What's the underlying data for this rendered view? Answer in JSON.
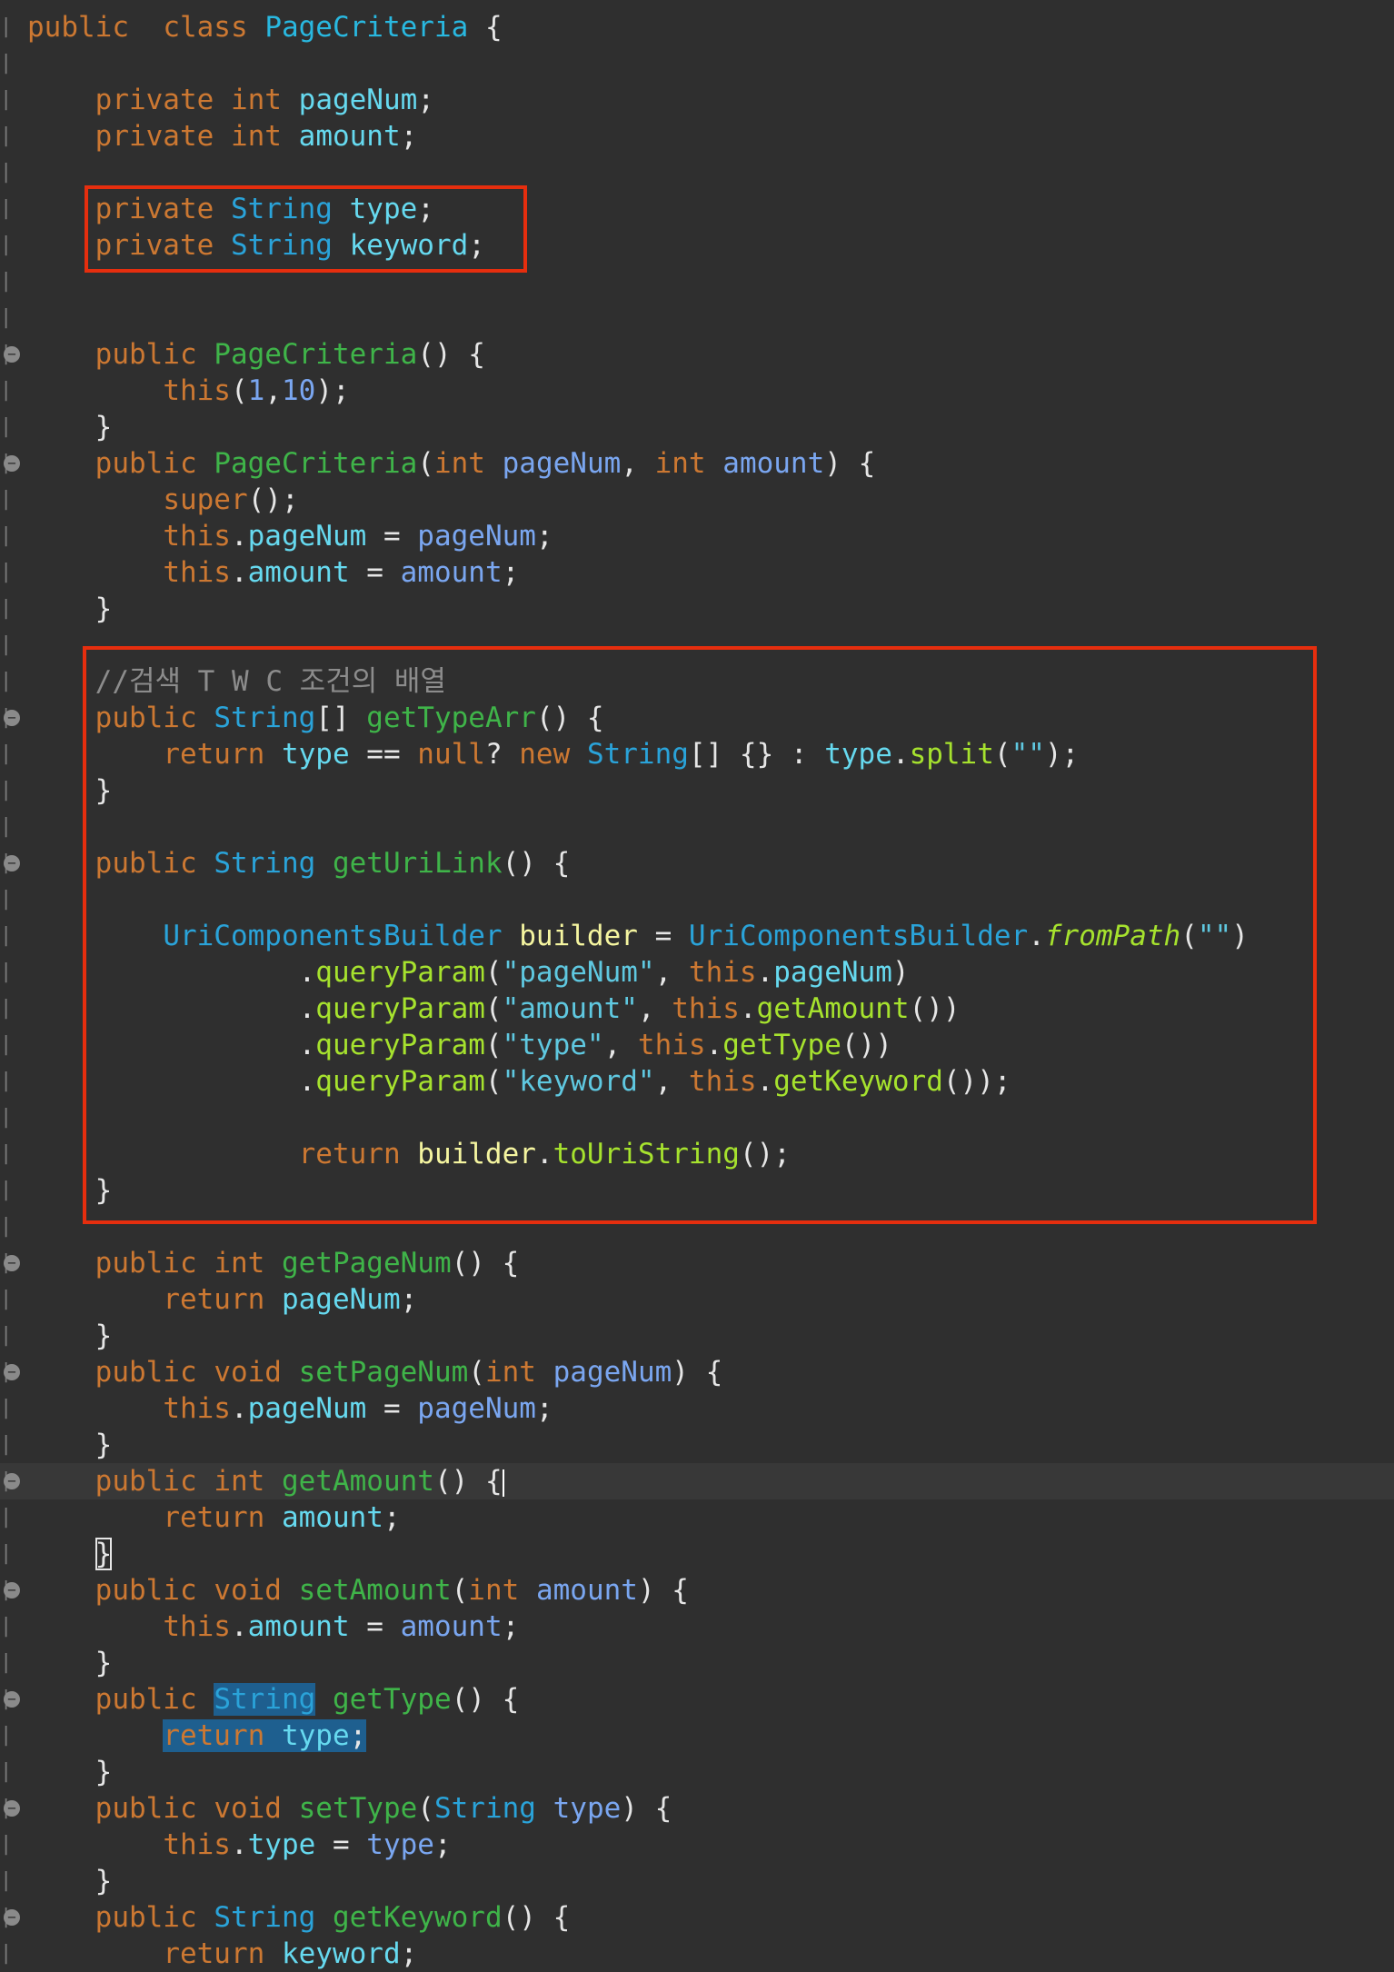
{
  "editor": {
    "language": "Java",
    "lines": [
      {
        "tokens": [
          [
            "kw",
            "public"
          ],
          [
            "",
            "  "
          ],
          [
            "kw",
            "class"
          ],
          [
            "",
            " "
          ],
          [
            "cls",
            "PageCriteria"
          ],
          [
            "",
            " {"
          ]
        ]
      },
      {
        "tokens": []
      },
      {
        "tokens": [
          [
            "",
            "    "
          ],
          [
            "kw",
            "private"
          ],
          [
            "",
            " "
          ],
          [
            "kw",
            "int"
          ],
          [
            "",
            " "
          ],
          [
            "fld",
            "pageNum"
          ],
          [
            "",
            ";"
          ]
        ]
      },
      {
        "tokens": [
          [
            "",
            "    "
          ],
          [
            "kw",
            "private"
          ],
          [
            "",
            " "
          ],
          [
            "kw",
            "int"
          ],
          [
            "",
            " "
          ],
          [
            "fld",
            "amount"
          ],
          [
            "",
            ";"
          ]
        ]
      },
      {
        "tokens": []
      },
      {
        "tokens": [
          [
            "",
            "    "
          ],
          [
            "kw",
            "private"
          ],
          [
            "",
            " "
          ],
          [
            "ty",
            "String"
          ],
          [
            "",
            " "
          ],
          [
            "fld",
            "type"
          ],
          [
            "",
            ";"
          ]
        ]
      },
      {
        "tokens": [
          [
            "",
            "    "
          ],
          [
            "kw",
            "private"
          ],
          [
            "",
            " "
          ],
          [
            "ty",
            "String"
          ],
          [
            "",
            " "
          ],
          [
            "fld",
            "keyword"
          ],
          [
            "",
            ";"
          ]
        ]
      },
      {
        "tokens": []
      },
      {
        "tokens": []
      },
      {
        "fold": true,
        "tokens": [
          [
            "",
            "    "
          ],
          [
            "kw",
            "public"
          ],
          [
            "",
            " "
          ],
          [
            "fn",
            "PageCriteria"
          ],
          [
            "",
            "() {"
          ]
        ]
      },
      {
        "tokens": [
          [
            "",
            "        "
          ],
          [
            "kw",
            "this"
          ],
          [
            "",
            "("
          ],
          [
            "num",
            "1"
          ],
          [
            "",
            ","
          ],
          [
            "num",
            "10"
          ],
          [
            "",
            ");"
          ]
        ]
      },
      {
        "tokens": [
          [
            "",
            "    }"
          ]
        ]
      },
      {
        "fold": true,
        "tokens": [
          [
            "",
            "    "
          ],
          [
            "kw",
            "public"
          ],
          [
            "",
            " "
          ],
          [
            "fn",
            "PageCriteria"
          ],
          [
            "",
            "("
          ],
          [
            "kw",
            "int"
          ],
          [
            "",
            " "
          ],
          [
            "par",
            "pageNum"
          ],
          [
            "",
            ", "
          ],
          [
            "kw",
            "int"
          ],
          [
            "",
            " "
          ],
          [
            "par",
            "amount"
          ],
          [
            "",
            ") {"
          ]
        ]
      },
      {
        "tokens": [
          [
            "",
            "        "
          ],
          [
            "kw",
            "super"
          ],
          [
            "",
            "();"
          ]
        ]
      },
      {
        "tokens": [
          [
            "",
            "        "
          ],
          [
            "kw",
            "this"
          ],
          [
            "",
            "."
          ],
          [
            "fld",
            "pageNum"
          ],
          [
            "",
            " = "
          ],
          [
            "par",
            "pageNum"
          ],
          [
            "",
            ";"
          ]
        ]
      },
      {
        "tokens": [
          [
            "",
            "        "
          ],
          [
            "kw",
            "this"
          ],
          [
            "",
            "."
          ],
          [
            "fld",
            "amount"
          ],
          [
            "",
            " = "
          ],
          [
            "par",
            "amount"
          ],
          [
            "",
            ";"
          ]
        ]
      },
      {
        "tokens": [
          [
            "",
            "    }"
          ]
        ]
      },
      {
        "tokens": []
      },
      {
        "tokens": [
          [
            "",
            "    "
          ],
          [
            "cm",
            "//검색 T W C 조건의 배열"
          ]
        ]
      },
      {
        "fold": true,
        "tokens": [
          [
            "",
            "    "
          ],
          [
            "kw",
            "public"
          ],
          [
            "",
            " "
          ],
          [
            "ty",
            "String"
          ],
          [
            "",
            "[] "
          ],
          [
            "fn",
            "getTypeArr"
          ],
          [
            "",
            "() {"
          ]
        ]
      },
      {
        "tokens": [
          [
            "",
            "        "
          ],
          [
            "kw",
            "return"
          ],
          [
            "",
            " "
          ],
          [
            "fld",
            "type"
          ],
          [
            "",
            " == "
          ],
          [
            "kw",
            "null"
          ],
          [
            "",
            "? "
          ],
          [
            "kw",
            "new"
          ],
          [
            "",
            " "
          ],
          [
            "ty",
            "String"
          ],
          [
            "",
            "[] {} : "
          ],
          [
            "fld",
            "type"
          ],
          [
            "",
            "."
          ],
          [
            "call",
            "split"
          ],
          [
            "",
            "("
          ],
          [
            "str",
            "\"\""
          ],
          [
            "",
            ");"
          ]
        ]
      },
      {
        "tokens": [
          [
            "",
            "    }"
          ]
        ]
      },
      {
        "tokens": []
      },
      {
        "fold": true,
        "tokens": [
          [
            "",
            "    "
          ],
          [
            "kw",
            "public"
          ],
          [
            "",
            " "
          ],
          [
            "ty",
            "String"
          ],
          [
            "",
            " "
          ],
          [
            "fn",
            "getUriLink"
          ],
          [
            "",
            "() {"
          ]
        ]
      },
      {
        "tokens": []
      },
      {
        "tokens": [
          [
            "",
            "        "
          ],
          [
            "ty",
            "UriComponentsBuilder"
          ],
          [
            "",
            " "
          ],
          [
            "loc",
            "builder"
          ],
          [
            "",
            " = "
          ],
          [
            "ty",
            "UriComponentsBuilder"
          ],
          [
            "",
            "."
          ],
          [
            "it",
            "fromPath"
          ],
          [
            "",
            "("
          ],
          [
            "str",
            "\"\""
          ],
          [
            "",
            ")"
          ]
        ]
      },
      {
        "tokens": [
          [
            "",
            "                ."
          ],
          [
            "call",
            "queryParam"
          ],
          [
            "",
            "("
          ],
          [
            "str",
            "\"pageNum\""
          ],
          [
            "",
            ", "
          ],
          [
            "kw",
            "this"
          ],
          [
            "",
            "."
          ],
          [
            "fld",
            "pageNum"
          ],
          [
            "",
            ")"
          ]
        ]
      },
      {
        "tokens": [
          [
            "",
            "                ."
          ],
          [
            "call",
            "queryParam"
          ],
          [
            "",
            "("
          ],
          [
            "str",
            "\"amount\""
          ],
          [
            "",
            ", "
          ],
          [
            "kw",
            "this"
          ],
          [
            "",
            "."
          ],
          [
            "call",
            "getAmount"
          ],
          [
            "",
            "())"
          ]
        ]
      },
      {
        "tokens": [
          [
            "",
            "                ."
          ],
          [
            "call",
            "queryParam"
          ],
          [
            "",
            "("
          ],
          [
            "str",
            "\"type\""
          ],
          [
            "",
            ", "
          ],
          [
            "kw",
            "this"
          ],
          [
            "",
            "."
          ],
          [
            "call",
            "getType"
          ],
          [
            "",
            "())"
          ]
        ]
      },
      {
        "tokens": [
          [
            "",
            "                ."
          ],
          [
            "call",
            "queryParam"
          ],
          [
            "",
            "("
          ],
          [
            "str",
            "\"keyword\""
          ],
          [
            "",
            ", "
          ],
          [
            "kw",
            "this"
          ],
          [
            "",
            "."
          ],
          [
            "call",
            "getKeyword"
          ],
          [
            "",
            "());"
          ]
        ]
      },
      {
        "tokens": []
      },
      {
        "tokens": [
          [
            "",
            "                "
          ],
          [
            "kw",
            "return"
          ],
          [
            "",
            " "
          ],
          [
            "loc",
            "builder"
          ],
          [
            "",
            "."
          ],
          [
            "call",
            "toUriString"
          ],
          [
            "",
            "();"
          ]
        ]
      },
      {
        "tokens": [
          [
            "",
            "    }"
          ]
        ]
      },
      {
        "tokens": []
      },
      {
        "fold": true,
        "tokens": [
          [
            "",
            "    "
          ],
          [
            "kw",
            "public"
          ],
          [
            "",
            " "
          ],
          [
            "kw",
            "int"
          ],
          [
            "",
            " "
          ],
          [
            "fn",
            "getPageNum"
          ],
          [
            "",
            "() {"
          ]
        ]
      },
      {
        "tokens": [
          [
            "",
            "        "
          ],
          [
            "kw",
            "return"
          ],
          [
            "",
            " "
          ],
          [
            "fld",
            "pageNum"
          ],
          [
            "",
            ";"
          ]
        ]
      },
      {
        "tokens": [
          [
            "",
            "    }"
          ]
        ]
      },
      {
        "fold": true,
        "tokens": [
          [
            "",
            "    "
          ],
          [
            "kw",
            "public"
          ],
          [
            "",
            " "
          ],
          [
            "kw",
            "void"
          ],
          [
            "",
            " "
          ],
          [
            "fn",
            "setPageNum"
          ],
          [
            "",
            "("
          ],
          [
            "kw",
            "int"
          ],
          [
            "",
            " "
          ],
          [
            "par",
            "pageNum"
          ],
          [
            "",
            ") {"
          ]
        ]
      },
      {
        "tokens": [
          [
            "",
            "        "
          ],
          [
            "kw",
            "this"
          ],
          [
            "",
            "."
          ],
          [
            "fld",
            "pageNum"
          ],
          [
            "",
            " = "
          ],
          [
            "par",
            "pageNum"
          ],
          [
            "",
            ";"
          ]
        ]
      },
      {
        "tokens": [
          [
            "",
            "    }"
          ]
        ]
      },
      {
        "fold": true,
        "current": true,
        "caret": true,
        "tokens": [
          [
            "",
            "    "
          ],
          [
            "kw",
            "public"
          ],
          [
            "",
            " "
          ],
          [
            "kw",
            "int"
          ],
          [
            "",
            " "
          ],
          [
            "fn",
            "getAmount"
          ],
          [
            "",
            "() {"
          ]
        ]
      },
      {
        "tokens": [
          [
            "",
            "        "
          ],
          [
            "kw",
            "return"
          ],
          [
            "",
            " "
          ],
          [
            "fld",
            "amount"
          ],
          [
            "",
            ";"
          ]
        ]
      },
      {
        "tokens": [
          [
            "",
            "    "
          ],
          [
            "boxed",
            "}"
          ]
        ]
      },
      {
        "fold": true,
        "tokens": [
          [
            "",
            "    "
          ],
          [
            "kw",
            "public"
          ],
          [
            "",
            " "
          ],
          [
            "kw",
            "void"
          ],
          [
            "",
            " "
          ],
          [
            "fn",
            "setAmount"
          ],
          [
            "",
            "("
          ],
          [
            "kw",
            "int"
          ],
          [
            "",
            " "
          ],
          [
            "par",
            "amount"
          ],
          [
            "",
            ") {"
          ]
        ]
      },
      {
        "tokens": [
          [
            "",
            "        "
          ],
          [
            "kw",
            "this"
          ],
          [
            "",
            "."
          ],
          [
            "fld",
            "amount"
          ],
          [
            "",
            " = "
          ],
          [
            "par",
            "amount"
          ],
          [
            "",
            ";"
          ]
        ]
      },
      {
        "tokens": [
          [
            "",
            "    }"
          ]
        ]
      },
      {
        "fold": true,
        "tokens": [
          [
            "",
            "    "
          ],
          [
            "kw",
            "public"
          ],
          [
            "",
            " "
          ],
          [
            "ty sel",
            "String"
          ],
          [
            "",
            " "
          ],
          [
            "fn",
            "getType"
          ],
          [
            "",
            "() {"
          ]
        ]
      },
      {
        "tokens": [
          [
            "",
            "        "
          ],
          [
            "kw sel",
            "return"
          ],
          [
            "sel",
            " "
          ],
          [
            "fld sel",
            "type"
          ],
          [
            "sel",
            ";"
          ]
        ]
      },
      {
        "tokens": [
          [
            "",
            "    }"
          ]
        ]
      },
      {
        "fold": true,
        "tokens": [
          [
            "",
            "    "
          ],
          [
            "kw",
            "public"
          ],
          [
            "",
            " "
          ],
          [
            "kw",
            "void"
          ],
          [
            "",
            " "
          ],
          [
            "fn",
            "setType"
          ],
          [
            "",
            "("
          ],
          [
            "ty",
            "String"
          ],
          [
            "",
            " "
          ],
          [
            "par",
            "type"
          ],
          [
            "",
            ") {"
          ]
        ]
      },
      {
        "tokens": [
          [
            "",
            "        "
          ],
          [
            "kw",
            "this"
          ],
          [
            "",
            "."
          ],
          [
            "fld",
            "type"
          ],
          [
            "",
            " = "
          ],
          [
            "par",
            "type"
          ],
          [
            "",
            ";"
          ]
        ]
      },
      {
        "tokens": [
          [
            "",
            "    }"
          ]
        ]
      },
      {
        "fold": true,
        "tokens": [
          [
            "",
            "    "
          ],
          [
            "kw",
            "public"
          ],
          [
            "",
            " "
          ],
          [
            "ty",
            "String"
          ],
          [
            "",
            " "
          ],
          [
            "fn",
            "getKeyword"
          ],
          [
            "",
            "() {"
          ]
        ]
      },
      {
        "tokens": [
          [
            "",
            "        "
          ],
          [
            "kw",
            "return"
          ],
          [
            "",
            " "
          ],
          [
            "fld",
            "keyword"
          ],
          [
            "",
            ";"
          ]
        ]
      }
    ],
    "highlight_boxes": [
      {
        "label": "fields-type-keyword"
      },
      {
        "label": "getTypeArr-getUriLink"
      }
    ]
  }
}
